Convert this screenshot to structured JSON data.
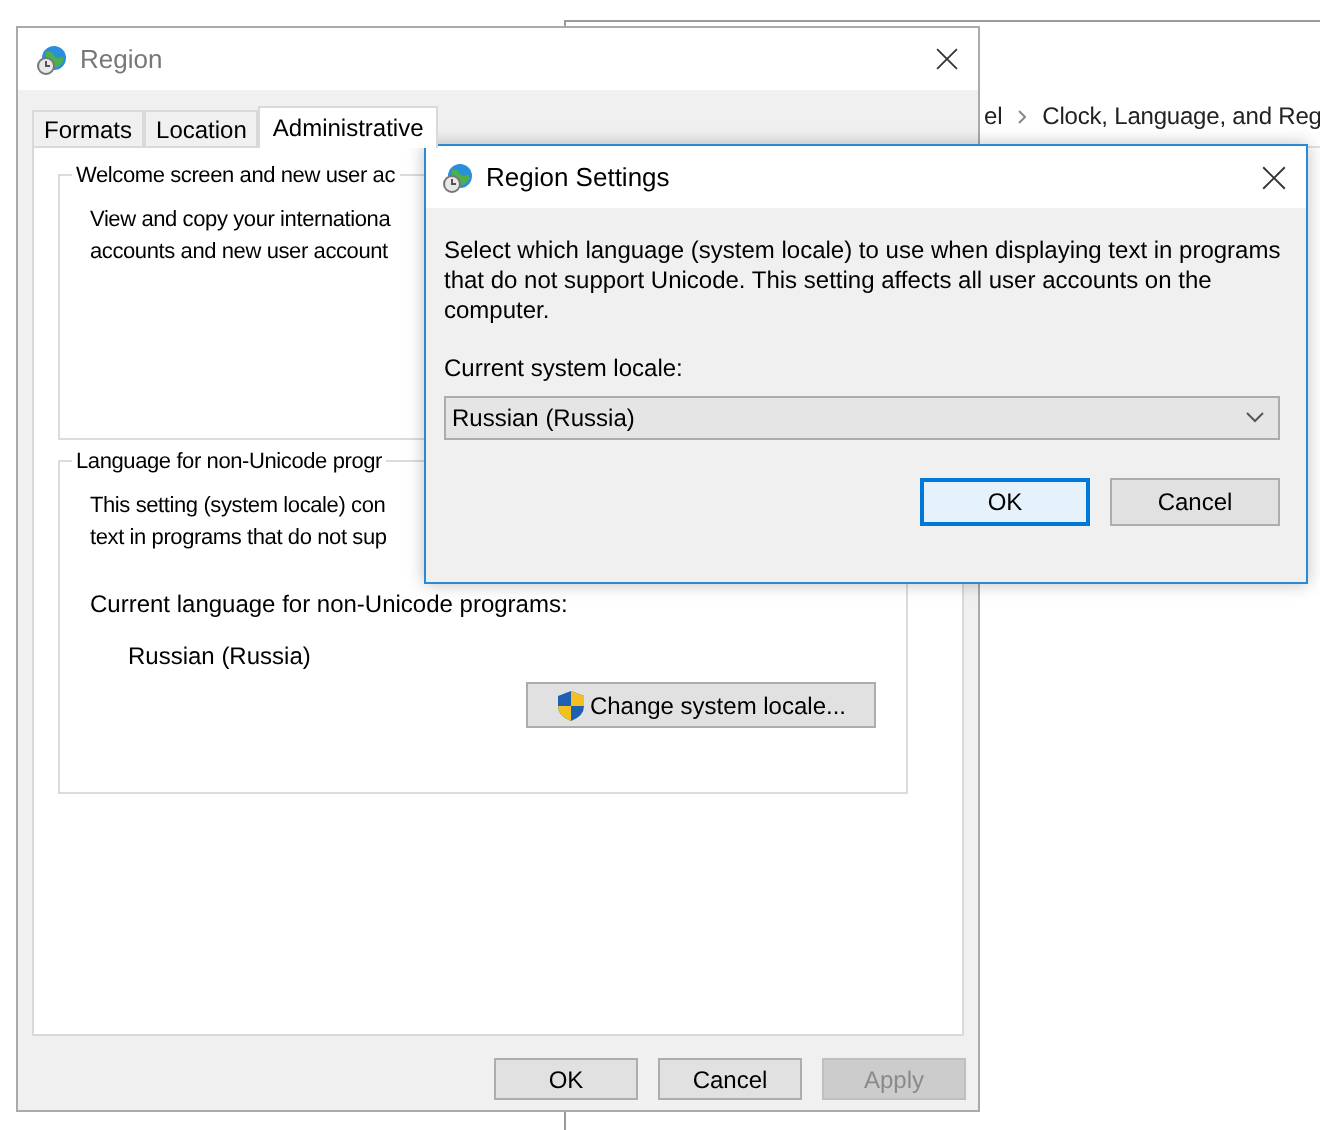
{
  "background_window": {
    "breadcrumb": [
      "el",
      "Clock, Language, and Reg"
    ]
  },
  "window": {
    "title": "Region",
    "tabs": [
      {
        "label": "Formats",
        "selected": false
      },
      {
        "label": "Location",
        "selected": false
      },
      {
        "label": "Administrative",
        "selected": true
      }
    ],
    "groups": [
      {
        "title": "Welcome screen and new user ac",
        "text": [
          "View and copy your internationa",
          "accounts and new user account"
        ]
      },
      {
        "title": "Language for non-Unicode progr",
        "text": [
          "This setting (system locale) con",
          "text in programs that do not sup"
        ],
        "current_label": "Current language for non-Unicode programs:",
        "current_value": "Russian (Russia)",
        "button": "Change system locale..."
      }
    ],
    "buttons": [
      {
        "label": "OK",
        "disabled": false
      },
      {
        "label": "Cancel",
        "disabled": false
      },
      {
        "label": "Apply",
        "disabled": true
      }
    ]
  },
  "dialog": {
    "title": "Region Settings",
    "description": "Select which language (system locale) to use when displaying text in programs that do not support Unicode. This setting affects all user accounts on the computer.",
    "locale_label": "Current system locale:",
    "locale_value": "Russian (Russia)",
    "buttons": [
      {
        "label": "OK",
        "default": true
      },
      {
        "label": "Cancel",
        "default": false
      }
    ]
  }
}
